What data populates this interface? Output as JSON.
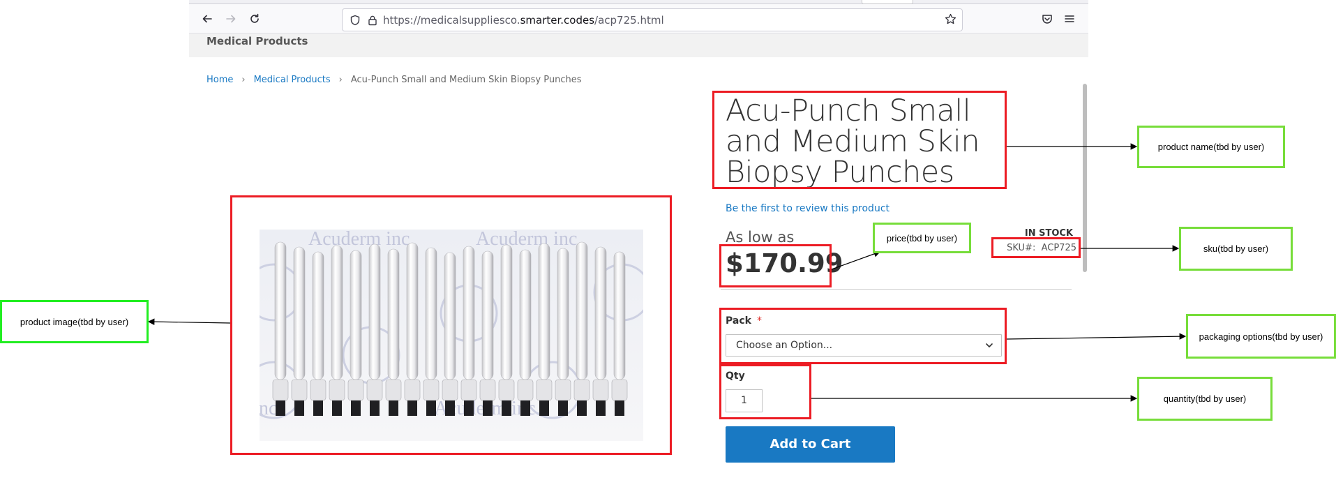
{
  "browser": {
    "url_prefix": "https://medicalsuppliesco.",
    "url_domain": "smarter.codes",
    "url_path": "/acp725.html"
  },
  "site": {
    "category_title": "Medical Products"
  },
  "breadcrumb": {
    "home": "Home",
    "category": "Medical Products",
    "current": "Acu-Punch Small and Medium Skin Biopsy Punches",
    "separator": "›"
  },
  "product": {
    "name": "Acu-Punch Small and Medium Skin Biopsy Punches",
    "review_link": "Be the first to review this product",
    "price_prefix": "As low as",
    "price": "$170.99",
    "stock_status": "IN STOCK",
    "sku_label": "SKU#:",
    "sku_value": "ACP725",
    "image_watermark": "Acuderm inc.",
    "options": {
      "pack_label": "Pack",
      "pack_required_mark": "*",
      "pack_selected": "Choose an Option...",
      "qty_label": "Qty",
      "qty_value": "1"
    },
    "add_to_cart": "Add to Cart"
  },
  "annotations": {
    "product_name": "product name(tbd by user)",
    "price": "price(tbd by user)",
    "sku": "sku(tbd by user)",
    "product_image": "product image(tbd by user)",
    "packaging": "packaging options(tbd by user)",
    "quantity": "quantity(tbd by user)",
    "colors": {
      "highlight": "#ec1c24",
      "label_border": "#77dd3a",
      "image_label_border": "#22ee22"
    }
  },
  "theme": {
    "link_color": "#1979c3",
    "button_color": "#1979c3",
    "required_color": "#e02b27"
  }
}
